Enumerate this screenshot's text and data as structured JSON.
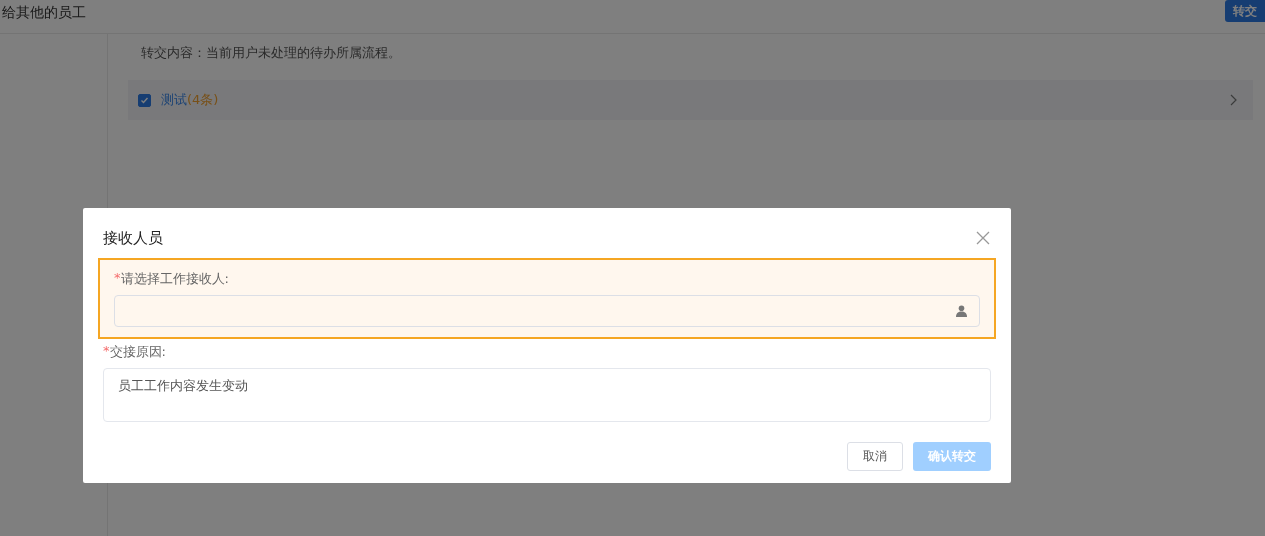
{
  "header": {
    "title": "给其他的员工",
    "action_button": "转交"
  },
  "content": {
    "description": "转交内容：当前用户未处理的待办所属流程。",
    "groups": [
      {
        "name": "测试",
        "count": "(4条)",
        "checked": true
      }
    ]
  },
  "dialog": {
    "title": "接收人员",
    "fields": [
      {
        "kind": "picker",
        "label": "请选择工作接收人:",
        "required_mark": "*",
        "highlighted": true
      },
      {
        "kind": "textarea",
        "label": "交接原因:",
        "required_mark": "*",
        "highlighted": false,
        "value": "员工工作内容发生变动"
      }
    ],
    "buttons": [
      {
        "label": "取消",
        "kind": "secondary"
      },
      {
        "label": "确认转交",
        "kind": "primary",
        "disabled": true
      }
    ]
  }
}
